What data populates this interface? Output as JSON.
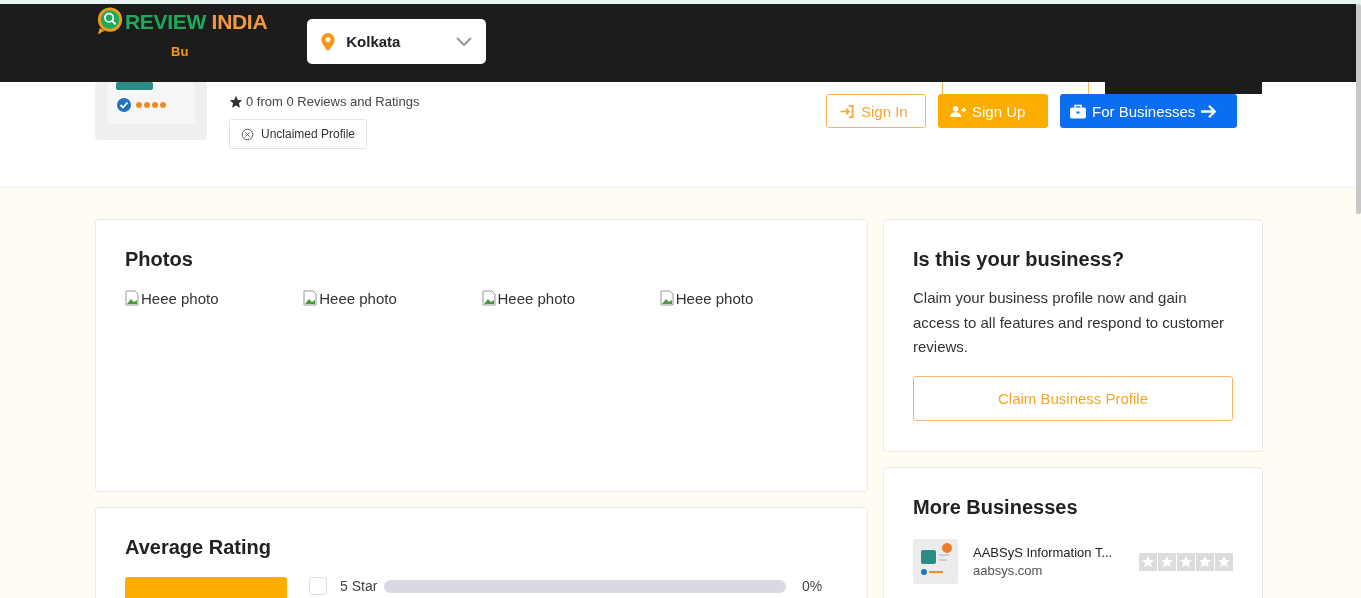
{
  "header": {
    "logo": {
      "part1": "REVIEW",
      "part2": "INDIA"
    },
    "tagline": "Bu",
    "location": {
      "value": "Kolkata"
    },
    "nav": [
      {
        "kind": "outline",
        "label": "Sign In"
      },
      {
        "kind": "filled",
        "label": "Sign Up"
      },
      {
        "kind": "primary",
        "label": "For Businesses"
      }
    ]
  },
  "profile": {
    "rating_text": "0 from 0 Reviews and Ratings",
    "claim_status": "Unclaimed Profile"
  },
  "photos": {
    "title": "Photos",
    "items": [
      {
        "alt": "Heee photo"
      },
      {
        "alt": "Heee photo"
      },
      {
        "alt": "Heee photo"
      },
      {
        "alt": "Heee photo"
      }
    ]
  },
  "average_rating": {
    "title": "Average Rating",
    "rows": [
      {
        "label": "5 Star",
        "checked": false,
        "level": 0,
        "reading": "0%"
      }
    ]
  },
  "claim_card": {
    "title": "Is this your business?",
    "text": "Claim your business profile now and gain access to all features and respond to customer reviews.",
    "button": "Claim Business Profile"
  },
  "more_businesses": {
    "title": "More Businesses",
    "items": [
      {
        "name": "AABSyS Information T...",
        "domain": "aabsys.com",
        "stars": 0
      }
    ]
  }
}
